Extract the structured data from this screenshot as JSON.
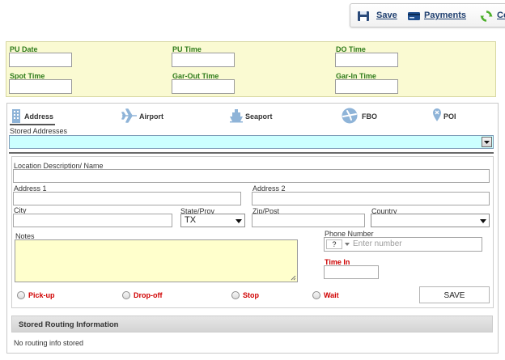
{
  "toolbar": {
    "save_label": "Save",
    "payments_label": "Payments",
    "third_label": "Co"
  },
  "times": {
    "pu_date": "PU Date",
    "pu_time": "PU Time",
    "do_time": "DO Time",
    "spot_time": "Spot Time",
    "gar_out_time": "Gar-Out Time",
    "gar_in_time": "Gar-In Time"
  },
  "tabs": {
    "address": "Address",
    "airport": "Airport",
    "seaport": "Seaport",
    "fbo": "FBO",
    "poi": "POI"
  },
  "stored_addresses": {
    "label": "Stored Addresses",
    "value": ""
  },
  "form": {
    "location_label": "Location Description/ Name",
    "address1_label": "Address 1",
    "address2_label": "Address 2",
    "city_label": "City",
    "state_label": "State/Prov",
    "state_value": "TX",
    "zip_label": "Zip/Post",
    "country_label": "Country",
    "country_value": "",
    "notes_label": "Notes",
    "phone_label": "Phone Number",
    "phone_country": "?",
    "phone_placeholder": "Enter number",
    "time_in_label": "Time In",
    "save_button": "SAVE"
  },
  "stop_types": [
    "Pick-up",
    "Drop-off",
    "Stop",
    "Wait"
  ],
  "routing": {
    "header": "Stored Routing Information",
    "empty_message": "No routing info stored"
  },
  "colors": {
    "time_label_green": "#2f7b1b",
    "time_panel_bg": "#fafad2",
    "stored_select_bg": "#ccffff",
    "notes_bg": "#ffffcc",
    "stop_type_red": "#d00000",
    "time_in_red": "#cc0000",
    "tab_icon_blue": "#8fb4d8"
  }
}
